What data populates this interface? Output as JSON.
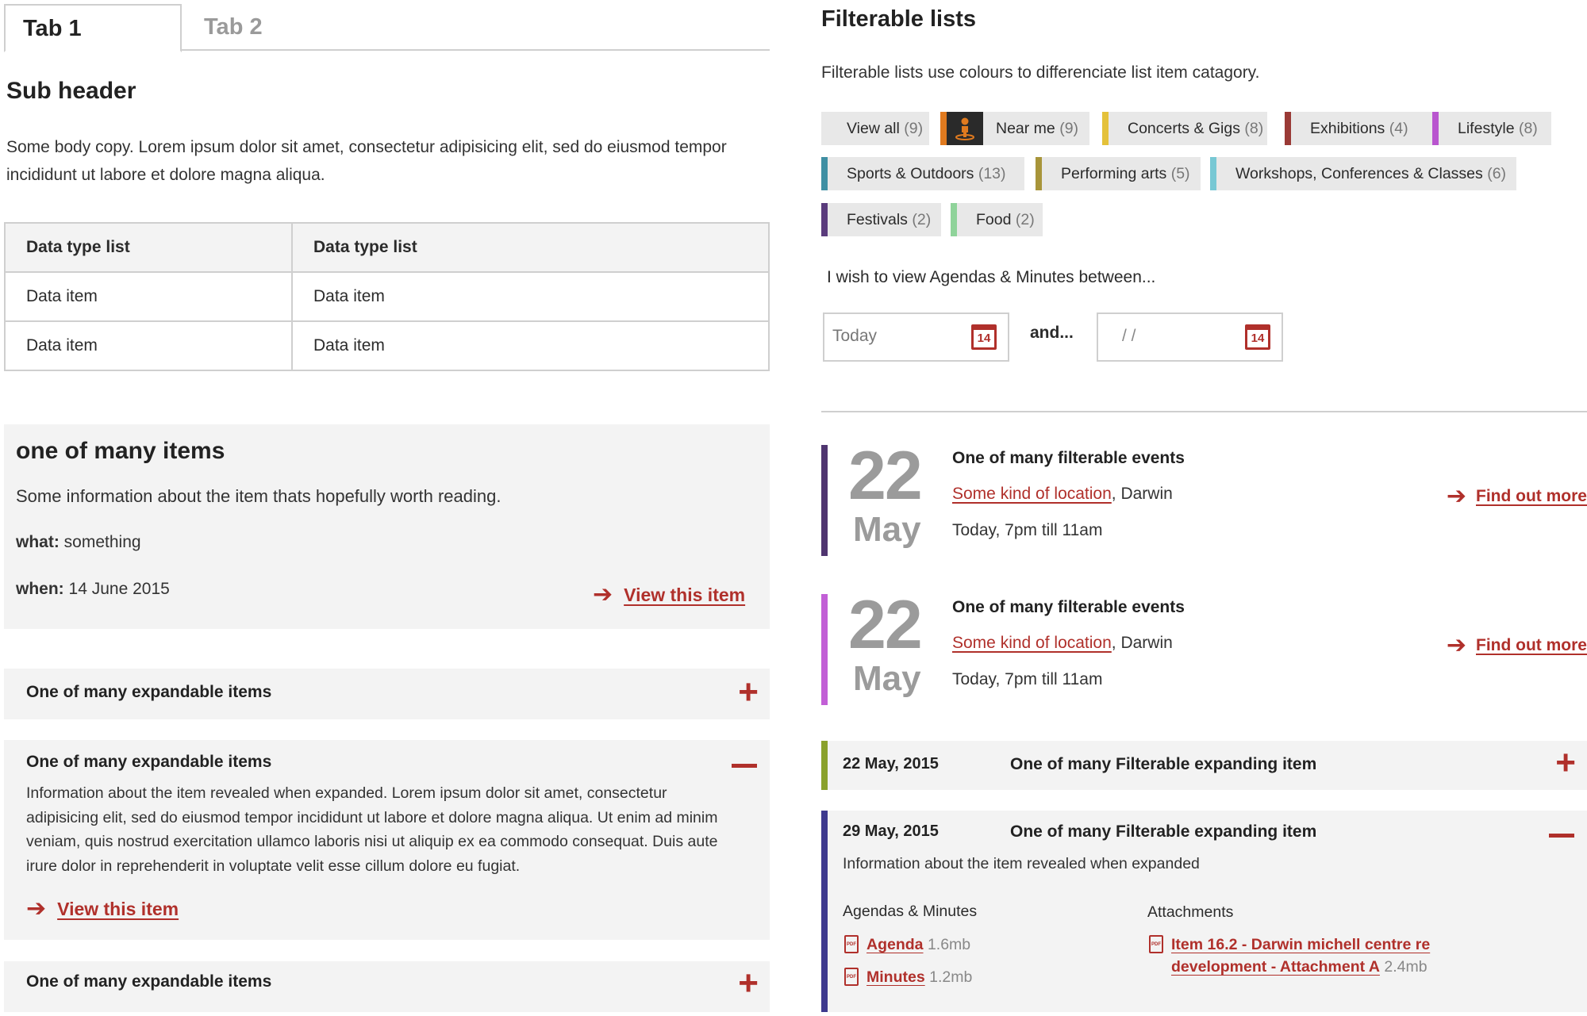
{
  "tabs": [
    {
      "label": "Tab 1"
    },
    {
      "label": "Tab 2"
    }
  ],
  "left": {
    "sub_header": "Sub header",
    "body_copy": "Some body copy. Lorem ipsum dolor sit amet, consectetur adipisicing elit, sed do eiusmod tempor incididunt ut labore et dolore magna aliqua.",
    "table": {
      "headers": [
        "Data type list",
        "Data type list"
      ],
      "rows": [
        [
          "Data item",
          "Data item"
        ],
        [
          "Data item",
          "Data item"
        ]
      ]
    },
    "card": {
      "title": "one of many items",
      "info": "Some information about the item thats hopefully worth reading.",
      "what_label": "what:",
      "what_value": "something",
      "when_label": "when:",
      "when_value": "14 June 2015",
      "link": "View this item"
    },
    "expandables": [
      {
        "title": "One of many expandable items"
      },
      {
        "title": "One of many expandable items",
        "body": "Information about the item revealed when expanded. Lorem ipsum dolor sit amet, consectetur adipisicing elit, sed do eiusmod tempor incididunt ut labore et dolore magna aliqua. Ut enim ad minim veniam, quis nostrud exercitation ullamco laboris nisi ut aliquip ex ea commodo consequat. Duis aute irure dolor in reprehenderit in voluptate velit esse cillum dolore eu fugiat.",
        "link": "View this item"
      },
      {
        "title": "One of many expandable items"
      }
    ]
  },
  "right": {
    "title": "Filterable lists",
    "intro": "Filterable lists use colours to differenciate list item catagory.",
    "filters": [
      {
        "label": "View all",
        "count": "(9)",
        "color": "#e8e8e8"
      },
      {
        "label": "Near me",
        "count": "(9)",
        "color": "#e07a1f",
        "icon": "person-location-icon"
      },
      {
        "label": "Concerts & Gigs",
        "count": "(8)",
        "color": "#e4c13a"
      },
      {
        "label": "Exhibitions",
        "count": "(4)",
        "color": "#9a3a36"
      },
      {
        "label": "Lifestyle",
        "count": "(8)",
        "color": "#b955cf"
      },
      {
        "label": "Sports & Outdoors",
        "count": "(13)",
        "color": "#3f8fa3"
      },
      {
        "label": "Performing arts",
        "count": "(5)",
        "color": "#a8953a"
      },
      {
        "label": "Workshops, Conferences & Classes",
        "count": "(6)",
        "color": "#78c8d4"
      },
      {
        "label": "Festivals",
        "count": "(2)",
        "color": "#5a3b7c"
      },
      {
        "label": "Food",
        "count": "(2)",
        "color": "#8fd39a"
      }
    ],
    "date_filter": {
      "label": "I wish to view Agendas & Minutes between...",
      "from_value": "Today",
      "and_label": "and...",
      "to_value": "/   /",
      "calendar_day": "14"
    },
    "events": [
      {
        "day": "22",
        "month": "May",
        "title": "One of many filterable events",
        "location": "Some kind of location",
        "location_suffix": ", Darwin",
        "time": "Today, 7pm till 11am",
        "link": "Find out more",
        "color": "#4f3570"
      },
      {
        "day": "22",
        "month": "May",
        "title": "One of many filterable events",
        "location": "Some kind of location",
        "location_suffix": ", Darwin",
        "time": "Today, 7pm till 11am",
        "link": "Find out more",
        "color": "#c25fd6"
      }
    ],
    "filterable_expanding": [
      {
        "date": "22 May, 2015",
        "title": "One of many Filterable expanding item",
        "color": "#8aa12c"
      },
      {
        "date": "29 May, 2015",
        "title": "One of many Filterable expanding item",
        "color": "#3e3a8e",
        "info": "Information about the item revealed when expanded",
        "agendas_heading": "Agendas & Minutes",
        "agendas": [
          {
            "name": "Agenda",
            "size": "1.6mb"
          },
          {
            "name": "Minutes",
            "size": "1.2mb"
          }
        ],
        "attachments_heading": "Attachments",
        "attachments": [
          {
            "name_line1": "Item 16.2 - Darwin michell centre re",
            "name_line2": "development - Attachment A",
            "size": "2.4mb"
          }
        ]
      }
    ]
  },
  "colors": {
    "accent": "#b0302b",
    "panel": "#f3f3f3",
    "border": "#cfcfcf"
  }
}
